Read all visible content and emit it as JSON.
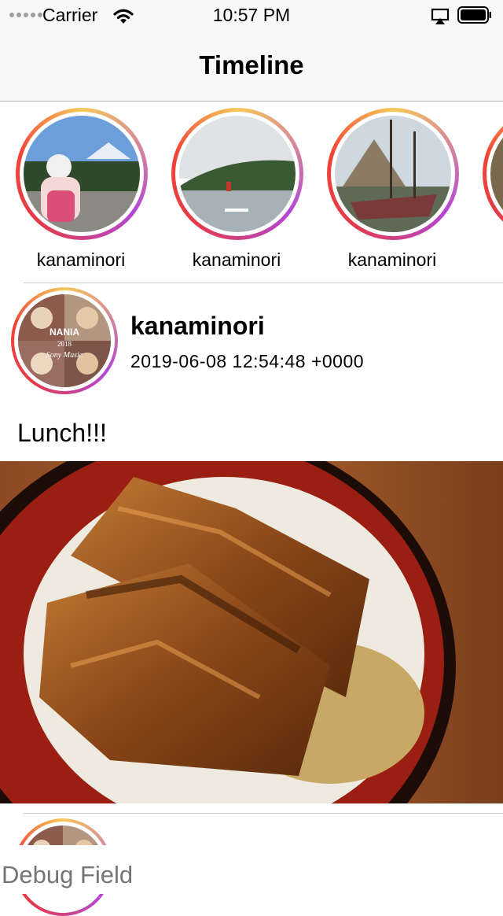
{
  "status_bar": {
    "carrier": "Carrier",
    "time": "10:57 PM",
    "wifi_icon": "wifi-icon",
    "airplay_icon": "airplay-icon",
    "battery_icon": "battery-full-icon"
  },
  "nav": {
    "title": "Timeline"
  },
  "stories": [
    {
      "username": "kanaminori"
    },
    {
      "username": "kanaminori"
    },
    {
      "username": "kanaminori"
    }
  ],
  "post": {
    "username": "kanaminori",
    "timestamp": "2019-06-08 12:54:48 +0000",
    "caption": "Lunch!!!",
    "avatar_text": [
      "NANIA",
      "2018",
      "Sony Music"
    ]
  },
  "debug": {
    "placeholder": "Debug Field"
  },
  "colors": {
    "ring_gradient": [
      "#f7c95a",
      "#b247d6",
      "#e23a4c",
      "#f44336"
    ],
    "bar_background": "#f8f8f8",
    "divider": "#cccccc",
    "placeholder_text": "#8e8e8e"
  }
}
